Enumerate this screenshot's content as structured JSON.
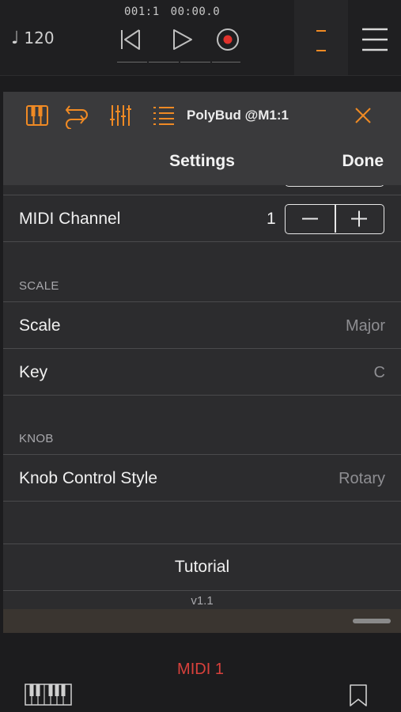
{
  "transport": {
    "tempo_symbol": "♩",
    "tempo": "120",
    "bar_position": "001:1",
    "time_position": "00:00.0",
    "buttons": [
      "rewind-icon",
      "play-icon",
      "record-icon"
    ],
    "record_color": "#e0322c"
  },
  "plugin": {
    "name": "PolyBud @M1:1",
    "toolbar_icons": [
      "piano-keys-icon",
      "routing-icon",
      "mixer-sliders-icon",
      "list-icon",
      "close-icon"
    ],
    "accent_color": "#f08a24"
  },
  "settings": {
    "title": "Settings",
    "done_label": "Done",
    "midi_channel": {
      "label": "MIDI Channel",
      "value": "1",
      "decrement": "−",
      "increment": "+"
    },
    "scale_section": {
      "title": "SCALE",
      "rows": [
        {
          "label": "Scale",
          "value": "Major"
        },
        {
          "label": "Key",
          "value": "C"
        }
      ]
    },
    "knob_section": {
      "title": "KNOB",
      "rows": [
        {
          "label": "Knob Control Style",
          "value": "Rotary"
        }
      ]
    },
    "tutorial_label": "Tutorial",
    "version": "v1.1"
  },
  "bottom": {
    "track_name": "MIDI 1",
    "track_color": "#d9413c",
    "icons": [
      "keyboard-icon",
      "bookmark-icon"
    ]
  }
}
